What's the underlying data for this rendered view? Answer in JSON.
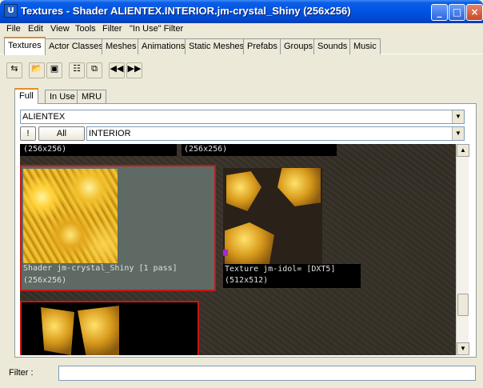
{
  "window": {
    "title": "Textures - Shader ALIENTEX.INTERIOR.jm-crystal_Shiny (256x256)",
    "app_icon_glyph": "U"
  },
  "menu": [
    "File",
    "Edit",
    "View",
    "Tools",
    "Filter",
    "\"In Use\" Filter"
  ],
  "tabs": [
    "Textures",
    "Actor Classes",
    "Meshes",
    "Animations",
    "Static Meshes",
    "Prefabs",
    "Groups",
    "Sounds",
    "Music"
  ],
  "active_tab": "Textures",
  "toolbar": {
    "icons": [
      "import-icon",
      "open-icon",
      "save-icon",
      "properties-icon",
      "duplicate-icon",
      "previous-icon",
      "next-icon"
    ]
  },
  "subtabs": [
    "Full",
    "In Use",
    "MRU"
  ],
  "active_subtab": "Full",
  "package_combo": {
    "value": "ALIENTEX"
  },
  "group_row": {
    "invert_label": "!",
    "all_label": "All",
    "group_value": "INTERIOR"
  },
  "browser": {
    "top_row_captions": [
      "(256x256)",
      "(256x256)"
    ],
    "tiles": [
      {
        "name": "Shader jm-crystal_Shiny [1 pass]",
        "size": "(256x256)",
        "selected": true
      },
      {
        "name": "Texture jm-idol= [DXT5]",
        "size": "(512x512)",
        "selected": false
      }
    ]
  },
  "filter": {
    "label": "Filter :",
    "value": ""
  },
  "colors": {
    "titlebar": "#0054e3",
    "selection_border": "#c41818",
    "tab_highlight": "#e68b2c"
  }
}
